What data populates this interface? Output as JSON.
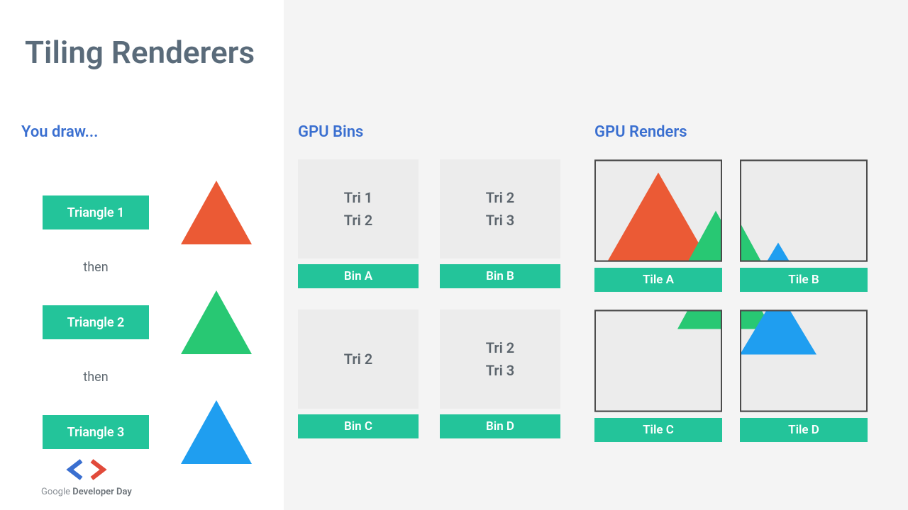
{
  "title": "Tiling Renderers",
  "sections": {
    "draw": "You draw...",
    "bins": "GPU Bins",
    "renders": "GPU Renders"
  },
  "draw": {
    "items": [
      "Triangle 1",
      "Triangle 2",
      "Triangle 3"
    ],
    "then": "then",
    "colors": [
      "#eb5a35",
      "#28c873",
      "#1f9ef0"
    ]
  },
  "bins": [
    {
      "label": "Bin A",
      "tris": [
        "Tri 1",
        "Tri 2"
      ]
    },
    {
      "label": "Bin B",
      "tris": [
        "Tri 2",
        "Tri 3"
      ]
    },
    {
      "label": "Bin C",
      "tris": [
        "Tri 2"
      ]
    },
    {
      "label": "Bin D",
      "tris": [
        "Tri 2",
        "Tri 3"
      ]
    }
  ],
  "tiles": [
    "Tile A",
    "Tile B",
    "Tile C",
    "Tile D"
  ],
  "footer": {
    "google": "Google",
    "rest": " Developer Day"
  },
  "palette": {
    "teal": "#23c49a",
    "orange": "#eb5a35",
    "green": "#28c873",
    "blue": "#1f9ef0"
  }
}
